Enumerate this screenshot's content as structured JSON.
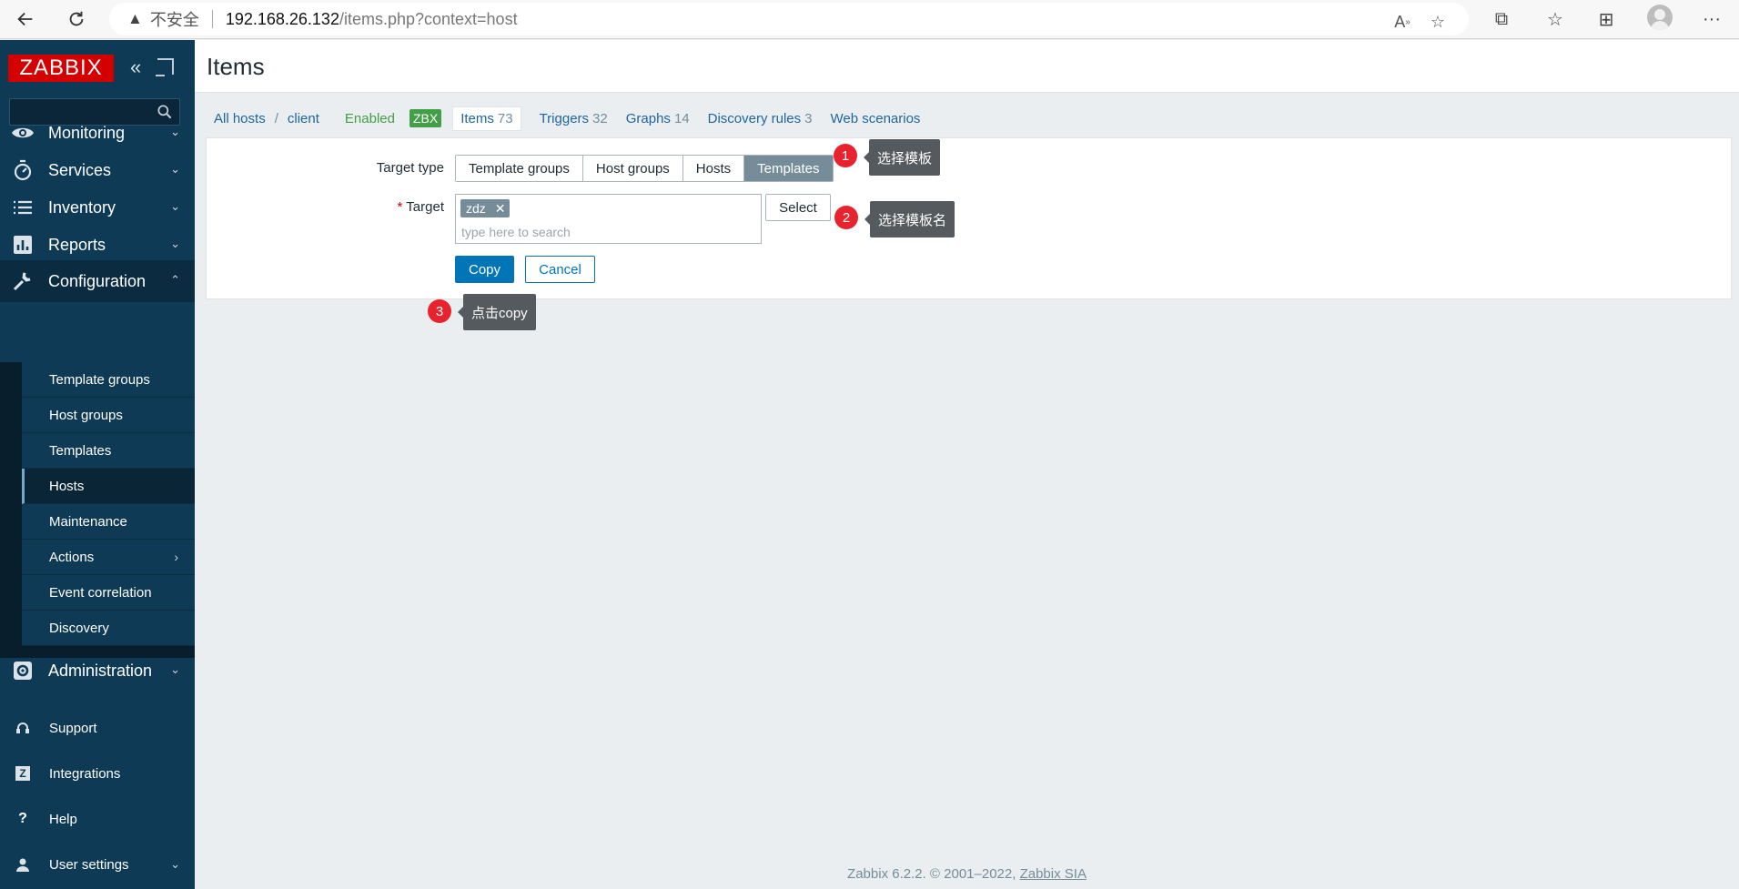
{
  "browser": {
    "insecure_label": "不安全",
    "url_host": "192.168.26.132",
    "url_path": "/items.php?context=host"
  },
  "sidebar": {
    "logo": "ZABBIX",
    "collapse_glyph": "«",
    "menu": [
      {
        "label": "Monitoring",
        "icon": "eye-icon"
      },
      {
        "label": "Services",
        "icon": "stopwatch-icon"
      },
      {
        "label": "Inventory",
        "icon": "list-icon"
      },
      {
        "label": "Reports",
        "icon": "bar-chart-icon"
      },
      {
        "label": "Configuration",
        "icon": "wrench-icon"
      }
    ],
    "submenu": [
      {
        "label": "Template groups"
      },
      {
        "label": "Host groups"
      },
      {
        "label": "Templates"
      },
      {
        "label": "Hosts"
      },
      {
        "label": "Maintenance"
      },
      {
        "label": "Actions"
      },
      {
        "label": "Event correlation"
      },
      {
        "label": "Discovery"
      }
    ],
    "administration": "Administration",
    "bottom": [
      {
        "label": "Support",
        "icon": "headset-icon"
      },
      {
        "label": "Integrations",
        "icon": "z-icon",
        "glyph": "Z"
      },
      {
        "label": "Help",
        "icon": "question-icon",
        "glyph": "?"
      },
      {
        "label": "User settings",
        "icon": "user-icon"
      }
    ]
  },
  "page": {
    "title": "Items"
  },
  "host_nav": {
    "all_hosts": "All hosts",
    "sep": "/",
    "host": "client",
    "status": "Enabled",
    "badge": "ZBX",
    "tabs": [
      {
        "label": "Items",
        "count": "73"
      },
      {
        "label": "Triggers",
        "count": "32"
      },
      {
        "label": "Graphs",
        "count": "14"
      },
      {
        "label": "Discovery rules",
        "count": "3"
      },
      {
        "label": "Web scenarios",
        "count": ""
      }
    ]
  },
  "form": {
    "target_type_label": "Target type",
    "target_type_options": [
      "Template groups",
      "Host groups",
      "Hosts",
      "Templates"
    ],
    "target_type_selected": "Templates",
    "target_label": "Target",
    "target_chip": "zdz",
    "target_chip_remove": "✕",
    "target_placeholder": "type here to search",
    "select_label": "Select",
    "copy_label": "Copy",
    "cancel_label": "Cancel"
  },
  "annotations": [
    {
      "num": "1",
      "text": "选择模板"
    },
    {
      "num": "2",
      "text": "选择模板名"
    },
    {
      "num": "3",
      "text": "点击copy"
    }
  ],
  "footer": {
    "text": "Zabbix 6.2.2. © 2001–2022, ",
    "link": "Zabbix SIA"
  },
  "colors": {
    "sidebar_bg": "#0e3a55",
    "logo_red": "#d40000",
    "link_blue": "#1f65a0",
    "primary_button": "#0275b8",
    "enabled_green": "#429e47",
    "annotation_red": "#e8232d"
  }
}
